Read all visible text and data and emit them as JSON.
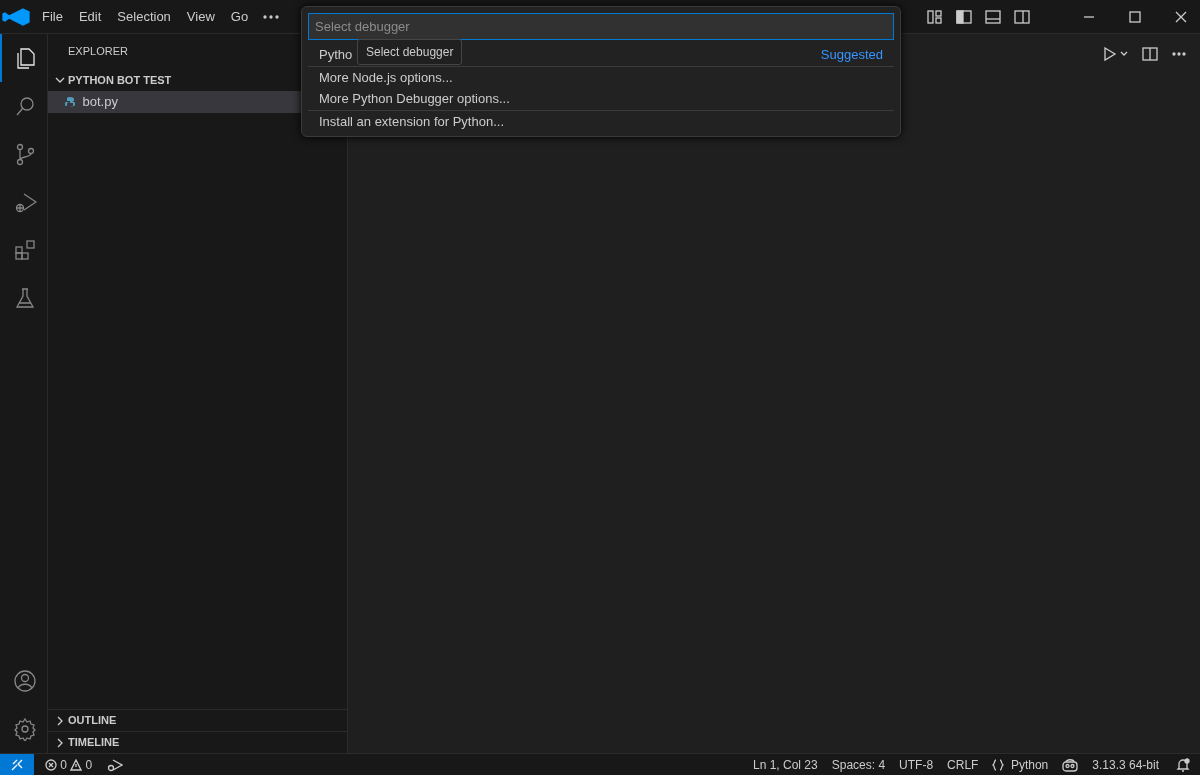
{
  "title_bar": {
    "menu": [
      {
        "label": "File"
      },
      {
        "label": "Edit"
      },
      {
        "label": "Selection"
      },
      {
        "label": "View"
      },
      {
        "label": "Go"
      }
    ]
  },
  "activity_bar": {
    "items": [
      {
        "kind": "explorer",
        "selected": true
      },
      {
        "kind": "search",
        "selected": false
      },
      {
        "kind": "source-control",
        "selected": false
      },
      {
        "kind": "run-debug",
        "selected": false
      },
      {
        "kind": "extensions",
        "selected": false
      },
      {
        "kind": "testing",
        "selected": false
      }
    ],
    "bottom": [
      {
        "kind": "account"
      },
      {
        "kind": "settings"
      }
    ]
  },
  "sidebar": {
    "title": "EXPLORER",
    "folder": {
      "label": "PYTHON BOT TEST",
      "expanded": true,
      "files": [
        {
          "name": "bot.py",
          "selected": true
        }
      ]
    },
    "sections": [
      {
        "label": "OUTLINE",
        "expanded": false
      },
      {
        "label": "TIMELINE",
        "expanded": false
      }
    ]
  },
  "quick_pick": {
    "placeholder": "Select debugger",
    "tooltip": "Select debugger",
    "groups": [
      [
        {
          "label": "Pytho",
          "description": "Suggested"
        }
      ],
      [
        {
          "label": "More Node.js options..."
        },
        {
          "label": "More Python Debugger options..."
        }
      ],
      [
        {
          "label": "Install an extension for Python..."
        }
      ]
    ]
  },
  "status_bar": {
    "errors": "0",
    "warnings": "0",
    "right": [
      {
        "kind": "text",
        "text": "Ln 1, Col 23"
      },
      {
        "kind": "text",
        "text": "Spaces: 4"
      },
      {
        "kind": "text",
        "text": "UTF-8"
      },
      {
        "kind": "text",
        "text": "CRLF"
      },
      {
        "kind": "language",
        "text": "Python"
      },
      {
        "kind": "copilot"
      },
      {
        "kind": "text",
        "text": "3.13.3 64-bit"
      },
      {
        "kind": "bell"
      }
    ]
  }
}
